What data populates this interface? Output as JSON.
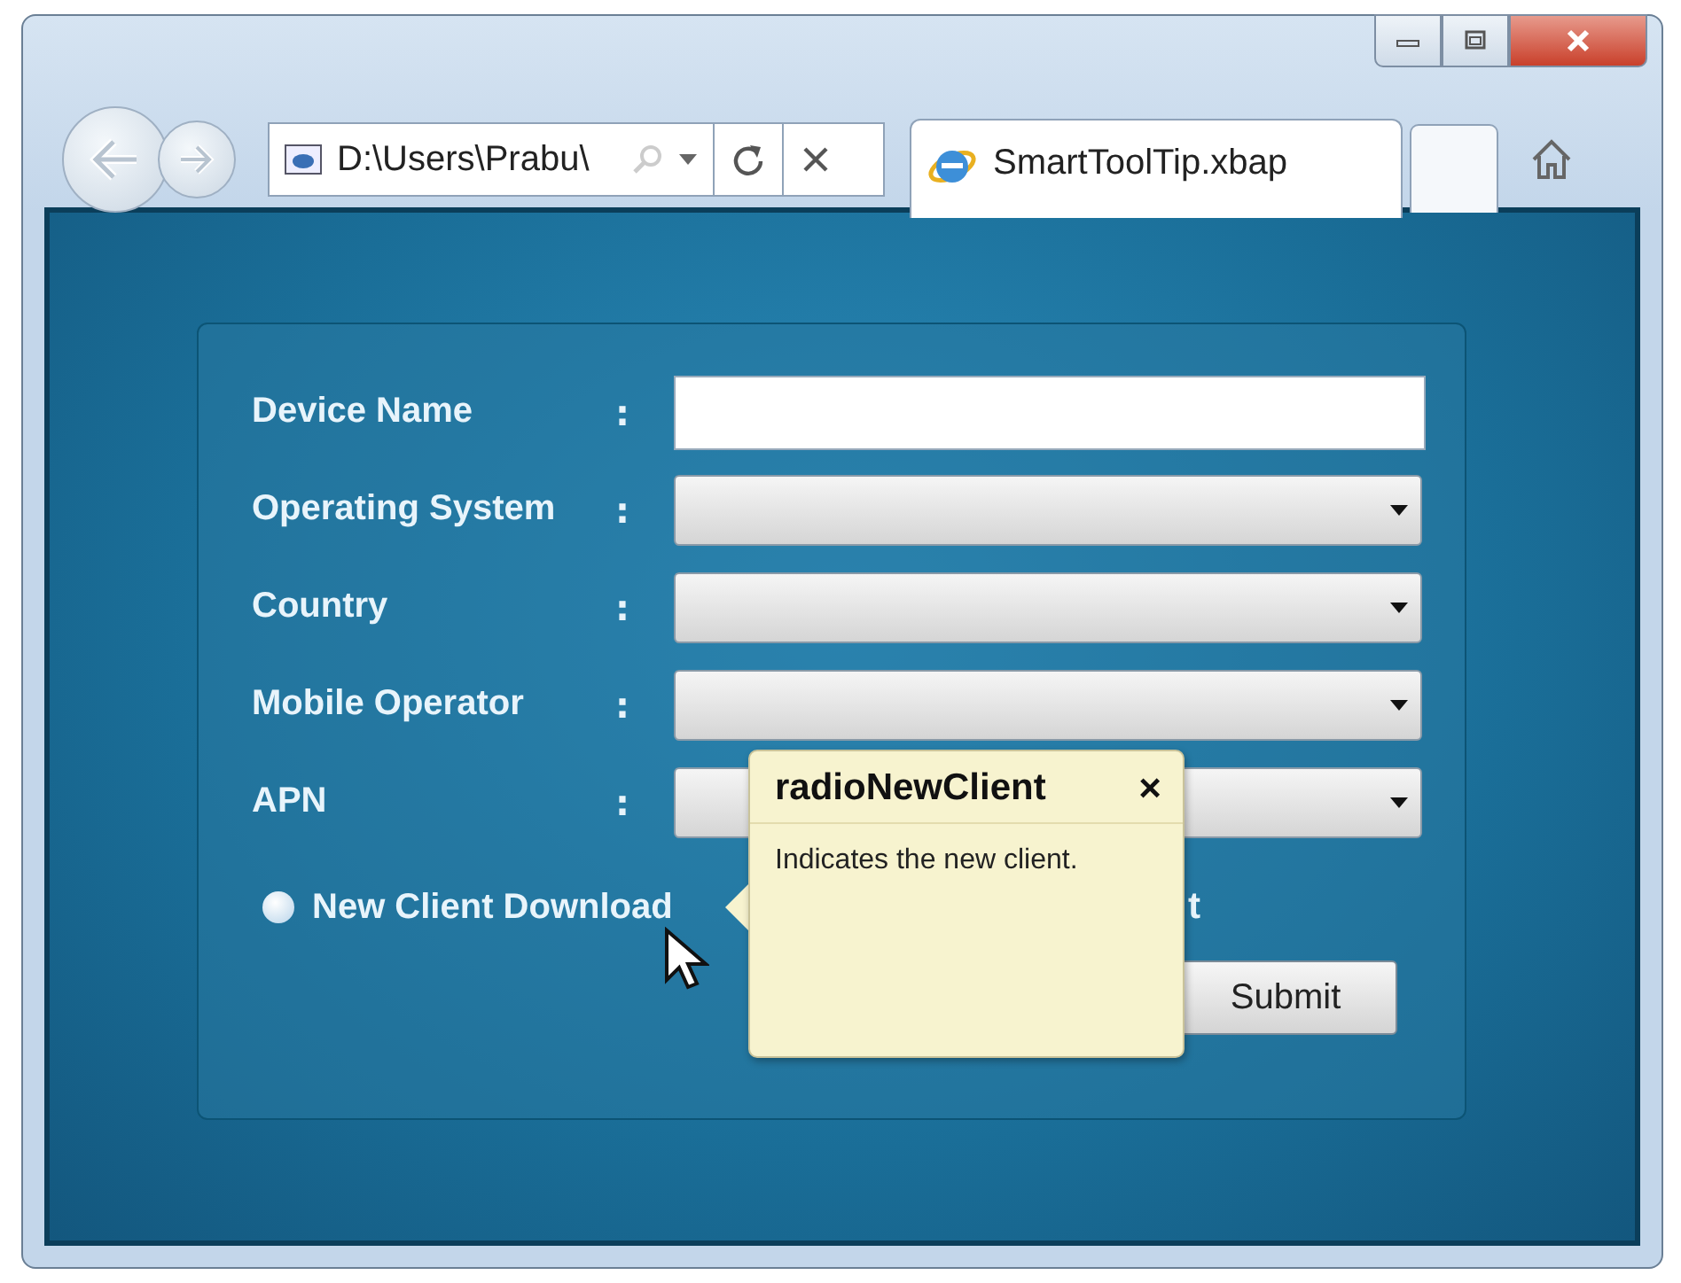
{
  "browser": {
    "address": "D:\\Users\\Prabu\\",
    "tab_title": "SmartToolTip.xbap"
  },
  "form": {
    "fields": [
      {
        "label": "Device Name",
        "colon": ":",
        "kind": "text"
      },
      {
        "label": "Operating System",
        "colon": ":",
        "kind": "dropdown"
      },
      {
        "label": "Country",
        "colon": ":",
        "kind": "dropdown"
      },
      {
        "label": "Mobile Operator",
        "colon": ":",
        "kind": "dropdown"
      },
      {
        "label": "APN",
        "colon": ":",
        "kind": "dropdown"
      }
    ],
    "radio": {
      "label": "New Client Download",
      "selected": false
    },
    "partial_option_text": "t",
    "submit": "Submit"
  },
  "tooltip": {
    "title": "radioNewClient",
    "close": "×",
    "text": "Indicates the new client."
  }
}
